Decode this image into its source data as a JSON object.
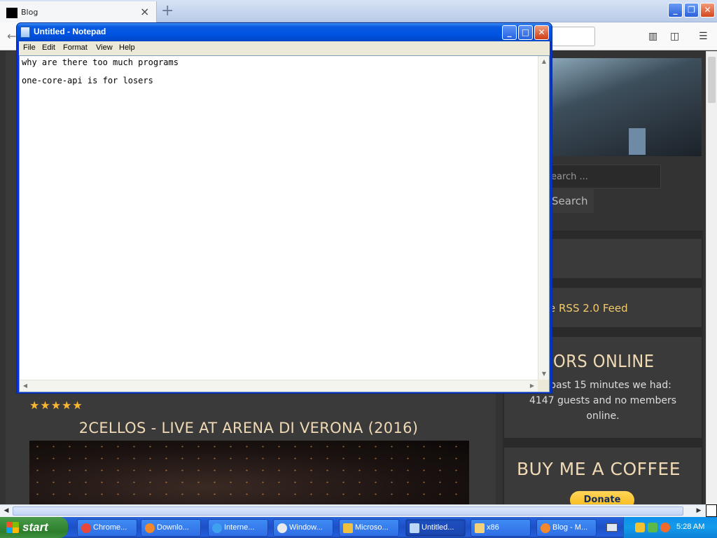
{
  "browser": {
    "tab_title": "Blog",
    "new_tab_symbol": "+",
    "close_tab_symbol": "×",
    "window_controls": {
      "minimize": "_",
      "maximize": "❐",
      "close": "✕"
    },
    "nav_icons": [
      "back-icon",
      "library-icon",
      "sidebar-icon",
      "menu-icon"
    ]
  },
  "page": {
    "sidebar": {
      "search_placeholder": "earch ...",
      "search_button": "Search",
      "rss_prefix": "e ",
      "rss_link": "RSS 2.0 Feed",
      "visitors_title": "ORS ONLINE",
      "visitors_text": "he past 15 minutes we had: 4147 guests and no members online.",
      "coffee_title": "BUY ME A COFFEE",
      "donate_button": "Donate"
    },
    "post": {
      "stars": "★★★★★",
      "rating": 5,
      "title": "2CELLOS - LIVE AT ARENA DI VERONA (2016)"
    }
  },
  "notepad": {
    "title": "Untitled - Notepad",
    "menu": [
      "File",
      "Edit",
      "Format",
      "View",
      "Help"
    ],
    "lines": [
      "why are there too much programs",
      "",
      "one-core-api is for losers"
    ]
  },
  "taskbar": {
    "start_label": "start",
    "tasks": [
      {
        "label": "Chrome...",
        "icon": "chrome-icon",
        "color": "#e9463b"
      },
      {
        "label": "Downlo...",
        "icon": "firefox-icon",
        "color": "#f2882d"
      },
      {
        "label": "Interne...",
        "icon": "ie-icon",
        "color": "#3fa0f0"
      },
      {
        "label": "Window...",
        "icon": "media-player-icon",
        "color": "#eaeaea"
      },
      {
        "label": "Microso...",
        "icon": "app-icon",
        "color": "#f0c040"
      },
      {
        "label": "Untitled...",
        "icon": "notepad-icon",
        "color": "#bcd8f7"
      },
      {
        "label": "x86",
        "icon": "folder-icon",
        "color": "#f4d27a"
      },
      {
        "label": "Blog - M...",
        "icon": "firefox-icon",
        "color": "#f2882d"
      }
    ],
    "clock": "5:28 AM"
  }
}
